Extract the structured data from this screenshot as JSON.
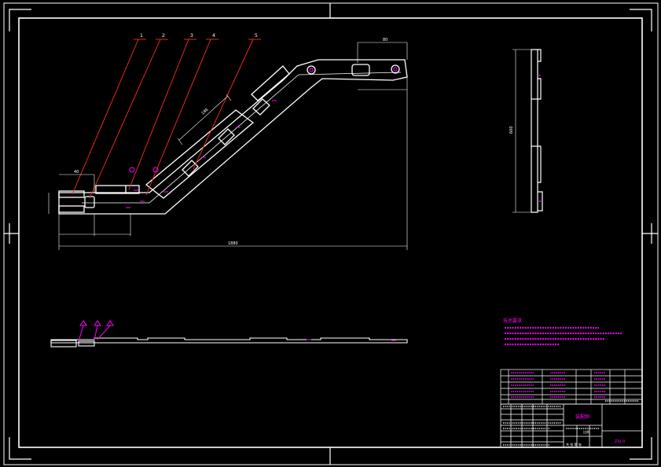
{
  "colors": {
    "background": "#000000",
    "outline": "#ffffff",
    "leader": "#ff2020",
    "dimension": "#ffffff",
    "annotation": "#ff00ff",
    "table_text": "#ff00ff"
  },
  "balloons": [
    "1",
    "2",
    "3",
    "4",
    "5"
  ],
  "dimensions": {
    "overall_length": "1880",
    "top_width": "80",
    "angled_length": "186",
    "left_width": "40",
    "height_right": "600"
  },
  "tech_notes": {
    "title": "技术要求"
  },
  "title_block": {
    "assembly_name": "装配图",
    "drawing_number": "ZXJ-0",
    "scale_row": "比例",
    "sheet_label": "共 张 第 张"
  }
}
